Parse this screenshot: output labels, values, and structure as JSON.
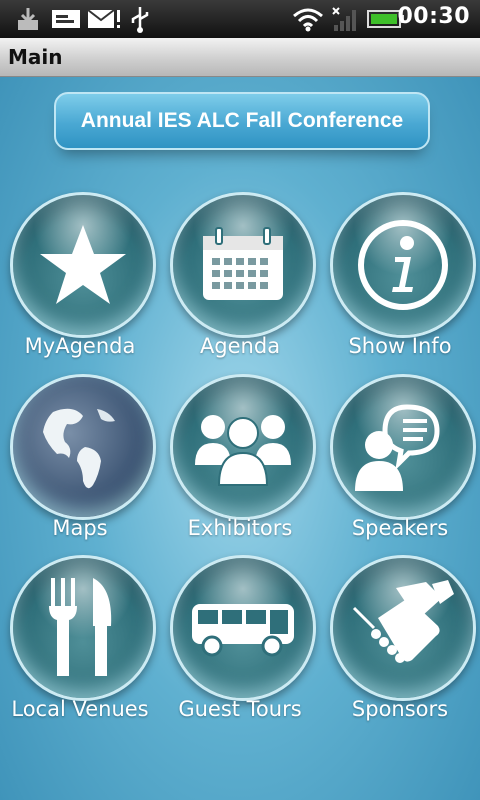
{
  "status_bar": {
    "time": "00:30",
    "icons": [
      "download-icon",
      "sms-icon",
      "email-icon",
      "usb-icon",
      "wifi-icon",
      "signal-icon",
      "battery-icon"
    ]
  },
  "title_bar": {
    "title": "Main"
  },
  "conference": {
    "title": "Annual IES ALC Fall Conference"
  },
  "grid": {
    "items": [
      {
        "label": "MyAgenda",
        "icon": "star-icon"
      },
      {
        "label": "Agenda",
        "icon": "calendar-icon"
      },
      {
        "label": "Show Info",
        "icon": "info-icon"
      },
      {
        "label": "Maps",
        "icon": "globe-icon"
      },
      {
        "label": "Exhibitors",
        "icon": "people-group-icon"
      },
      {
        "label": "Speakers",
        "icon": "speaker-icon"
      },
      {
        "label": "Local Venues",
        "icon": "fork-knife-icon"
      },
      {
        "label": "Guest Tours",
        "icon": "bus-icon"
      },
      {
        "label": "Sponsors",
        "icon": "handshake-icon"
      }
    ]
  },
  "colors": {
    "background": "#5fb0d0",
    "pill": "#4aa8d3",
    "bubble": "#2f6f7a",
    "battery": "#3fbf2a"
  }
}
